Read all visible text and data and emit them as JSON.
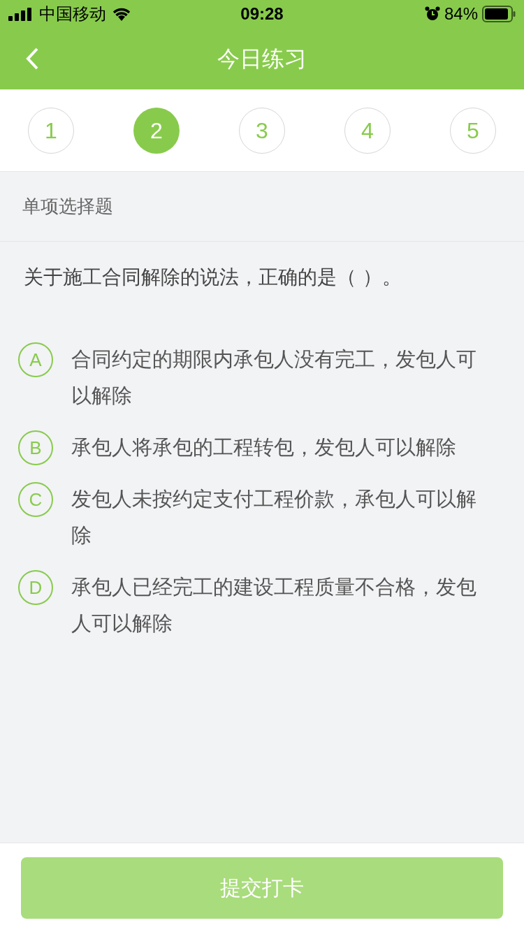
{
  "status_bar": {
    "carrier": "中国移动",
    "time": "09:28",
    "battery": "84%"
  },
  "nav": {
    "title": "今日练习"
  },
  "question_tabs": [
    {
      "label": "1",
      "selected": false
    },
    {
      "label": "2",
      "selected": true
    },
    {
      "label": "3",
      "selected": false
    },
    {
      "label": "4",
      "selected": false
    },
    {
      "label": "5",
      "selected": false
    }
  ],
  "question_type": "单项选择题",
  "question": "关于施工合同解除的说法，正确的是（    ）。",
  "options": [
    {
      "letter": "A",
      "text": "合同约定的期限内承包人没有完工，发包人可以解除",
      "selected": false
    },
    {
      "letter": "B",
      "text": "承包人将承包的工程转包，发包人可以解除",
      "selected": false
    },
    {
      "letter": "C",
      "text": "发包人未按约定支付工程价款，承包人可以解除",
      "selected": false
    },
    {
      "letter": "D",
      "text": "承包人已经完工的建设工程质量不合格，发包人可以解除",
      "selected": false
    }
  ],
  "submit": {
    "label": "提交打卡",
    "disabled": true
  }
}
